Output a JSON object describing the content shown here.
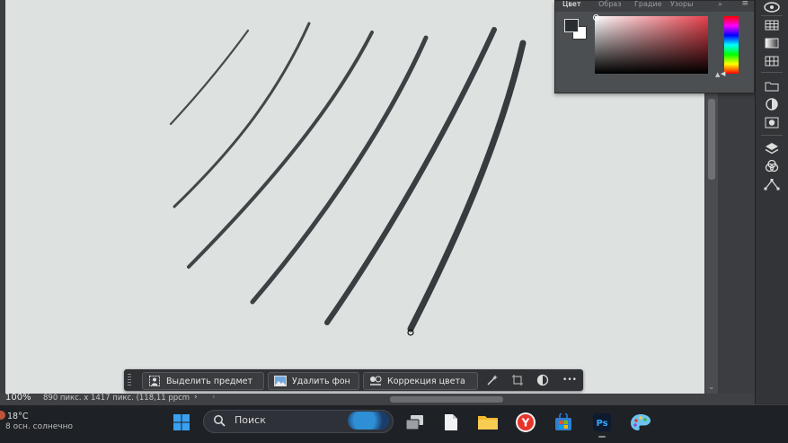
{
  "color_panel": {
    "tabs": [
      "Цвет",
      "Образ",
      "Градие",
      "Узоры"
    ],
    "active_tab": "Цвет",
    "more_label": "»",
    "menu_label": "≡",
    "foreground_color": "#2a2d30",
    "background_color": "#ffffff",
    "hue_color": "#e8404c"
  },
  "contextual_task_bar": {
    "buttons": [
      {
        "label": "Выделить предмет",
        "icon": "person-select-icon"
      },
      {
        "label": "Удалить фон",
        "icon": "remove-background-icon"
      },
      {
        "label": "Коррекция цвета",
        "icon": "color-adjust-icon"
      }
    ],
    "tools": [
      "magic-wand-icon",
      "crop-transform-icon",
      "adjustment-circle-icon"
    ],
    "more_label": "•••"
  },
  "status_bar": {
    "zoom": "100%",
    "document_info": "890 пикс. x 1417 пикс. (118,11 ppcm",
    "arrow": "›",
    "scroll_arrow": "‹"
  },
  "right_toolbar": {
    "icons": [
      "plugins-icon",
      "table-icon",
      "gradient-icon",
      "grid-icon",
      "folder-icon",
      "adjust-icon",
      "masks-icon",
      "layers-icon",
      "channels-icon",
      "paths-icon"
    ]
  },
  "taskbar": {
    "weather_temp": "18°C",
    "weather_desc": "8 осн. солнечно",
    "search_label": "Поиск",
    "apps": [
      "windows-start-icon",
      "task-view-icon",
      "file-icon",
      "file-explorer-icon",
      "yandex-browser-icon",
      "microsoft-store-icon",
      "photoshop-icon",
      "paint-icon"
    ],
    "photoshop_label": "Ps",
    "yandex_label": "Y"
  },
  "colors": {
    "canvas": "#dde2e1",
    "stroke": "#3a3e40",
    "panel": "#4c4f52",
    "taskbar": "#1e2126"
  }
}
